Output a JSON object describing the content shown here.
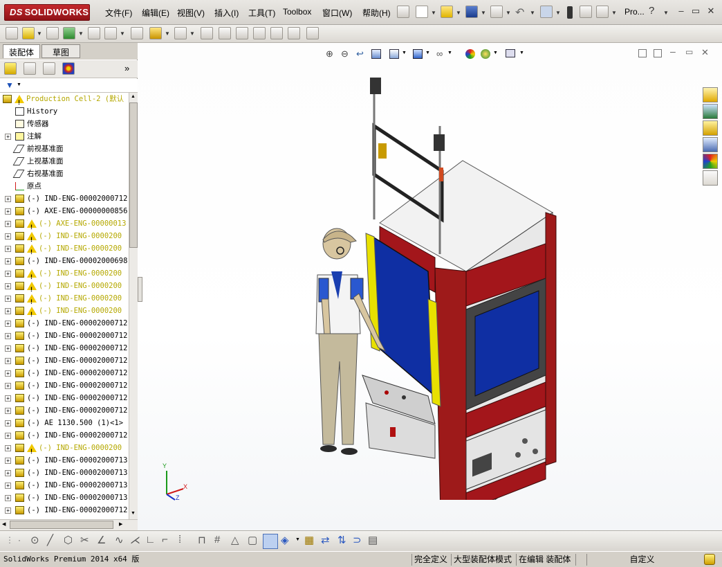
{
  "app": {
    "logo_text": "SOLIDWORKS",
    "logo_prefix": "DS"
  },
  "menu": [
    "文件(F)",
    "编辑(E)",
    "视图(V)",
    "插入(I)",
    "工具(T)",
    "Toolbox",
    "窗口(W)",
    "帮助(H)"
  ],
  "search_label": "Pro...",
  "left_tabs": [
    "装配体",
    "草图"
  ],
  "tree": [
    {
      "label": "Production Cell-2  (默认",
      "kind": "root",
      "warn": true
    },
    {
      "label": "History",
      "kind": "history"
    },
    {
      "label": "传感器",
      "kind": "sensor"
    },
    {
      "label": "注解",
      "kind": "annot",
      "expand": true
    },
    {
      "label": "前视基准面",
      "kind": "plane"
    },
    {
      "label": "上视基准面",
      "kind": "plane"
    },
    {
      "label": "右视基准面",
      "kind": "plane"
    },
    {
      "label": "原点",
      "kind": "origin"
    },
    {
      "label": "(-) IND-ENG-00002000712",
      "kind": "part",
      "expand": true
    },
    {
      "label": "(-) AXE-ENG-00000000856",
      "kind": "part",
      "expand": true
    },
    {
      "label": "(-) AXE-ENG-00000013",
      "kind": "part",
      "expand": true,
      "warn": true
    },
    {
      "label": "(-) IND-ENG-0000200",
      "kind": "part",
      "expand": true,
      "warn": true
    },
    {
      "label": "(-) IND-ENG-0000200",
      "kind": "part",
      "expand": true,
      "warn": true
    },
    {
      "label": "(-) IND-ENG-00002000698",
      "kind": "part",
      "expand": true
    },
    {
      "label": "(-) IND-ENG-0000200",
      "kind": "part",
      "expand": true,
      "warn": true
    },
    {
      "label": "(-) IND-ENG-0000200",
      "kind": "part",
      "expand": true,
      "warn": true
    },
    {
      "label": "(-) IND-ENG-0000200",
      "kind": "part",
      "expand": true,
      "warn": true
    },
    {
      "label": "(-) IND-ENG-0000200",
      "kind": "part",
      "expand": true,
      "warn": true
    },
    {
      "label": "(-) IND-ENG-00002000712",
      "kind": "part",
      "expand": true
    },
    {
      "label": "(-) IND-ENG-00002000712",
      "kind": "part",
      "expand": true
    },
    {
      "label": "(-) IND-ENG-00002000712",
      "kind": "part",
      "expand": true
    },
    {
      "label": "(-) IND-ENG-00002000712",
      "kind": "part",
      "expand": true
    },
    {
      "label": "(-) IND-ENG-00002000712",
      "kind": "part",
      "expand": true
    },
    {
      "label": "(-) IND-ENG-00002000712",
      "kind": "part",
      "expand": true
    },
    {
      "label": "(-) IND-ENG-00002000712",
      "kind": "part",
      "expand": true
    },
    {
      "label": "(-) IND-ENG-00002000712",
      "kind": "part",
      "expand": true
    },
    {
      "label": "(-) AE 1130.500  (1)<1>",
      "kind": "part",
      "expand": true
    },
    {
      "label": "(-) IND-ENG-00002000712",
      "kind": "part",
      "expand": true
    },
    {
      "label": "(-) IND-ENG-0000200",
      "kind": "part",
      "expand": true,
      "warn": true
    },
    {
      "label": "(-) IND-ENG-00002000713",
      "kind": "part",
      "expand": true
    },
    {
      "label": "(-) IND-ENG-00002000713",
      "kind": "part",
      "expand": true
    },
    {
      "label": "(-) IND-ENG-00002000713",
      "kind": "part",
      "expand": true
    },
    {
      "label": "(-) IND-ENG-00002000713",
      "kind": "part",
      "expand": true
    },
    {
      "label": "(-) IND-ENG-00002000712",
      "kind": "part",
      "expand": true
    }
  ],
  "status": {
    "version": "SolidWorks Premium 2014 x64 版",
    "definition": "完全定义",
    "mode": "大型装配体模式",
    "editing": "在编辑 装配体",
    "custom": "自定义"
  },
  "triad": {
    "x": "X",
    "y": "Y",
    "z": "Z"
  },
  "colors": {
    "panel_red": "#a3161b",
    "panel_blue": "#0f2fa3",
    "guard_yellow": "#e8e000",
    "frame_gray": "#c9c9c9",
    "warn_text": "#b5a800"
  }
}
